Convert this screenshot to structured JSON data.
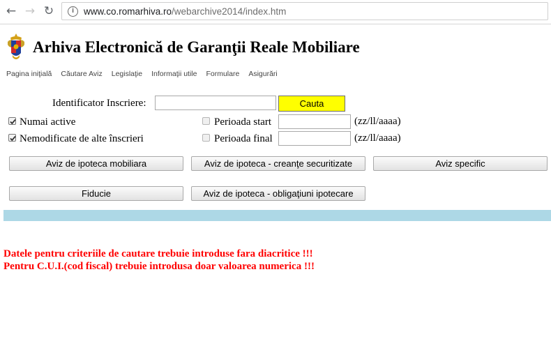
{
  "browser": {
    "url_host": "www.co.romarhiva.ro",
    "url_path": "/webarchive2014/index.htm"
  },
  "site": {
    "title": "Arhiva Electronică de Garanţii Reale Mobiliare"
  },
  "menu": [
    {
      "label": "Pagina iniţială"
    },
    {
      "label": "Căutare Aviz"
    },
    {
      "label": "Legislaţie"
    },
    {
      "label": "Informaţii utile"
    },
    {
      "label": "Formulare"
    },
    {
      "label": "Asigurări"
    }
  ],
  "search": {
    "identifier_label": "Identificator Inscriere:",
    "identifier_value": "",
    "search_button": "Cauta",
    "active_only_label": "Numai active",
    "active_only_checked": true,
    "unmodified_label": "Nemodificate de alte înscrieri",
    "unmodified_checked": true,
    "period_start_label": "Perioada start",
    "period_start_checked": false,
    "period_start_value": "",
    "period_end_label": "Perioada final",
    "period_end_checked": false,
    "period_end_value": "",
    "date_format": "(zz/ll/aaaa)"
  },
  "buttons": {
    "aviz_mobiliara": "Aviz de ipoteca mobiliara",
    "aviz_creante": "Aviz de ipoteca - creanţe securitizate",
    "aviz_specific": "Aviz specific",
    "fiducie": "Fiducie",
    "aviz_obligatiuni": "Aviz de ipoteca - obligaţiuni ipotecare"
  },
  "warnings": {
    "line1": "Datele pentru criteriile de cautare trebuie introduse fara diacritice !!!",
    "line2": "Pentru C.U.I.(cod fiscal) trebuie introdusa doar valoarea numerica !!!"
  },
  "colors": {
    "search_button": "#ffff00",
    "divider_bar": "#add8e6",
    "warning_text": "#ff0000"
  },
  "icons": {
    "back": "back-arrow-icon",
    "forward": "forward-arrow-icon",
    "reload": "reload-icon",
    "info": "info-icon",
    "crest": "romanian-coat-of-arms-icon",
    "check": "checkmark-icon"
  }
}
